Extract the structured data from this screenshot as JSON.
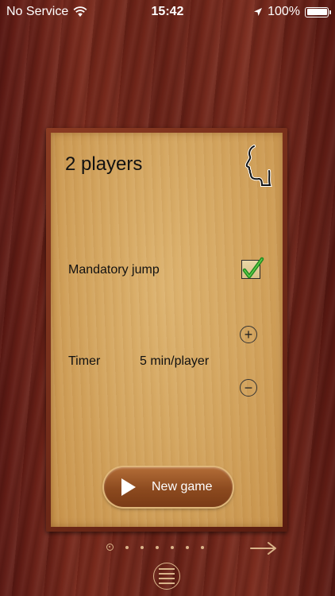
{
  "status_bar": {
    "carrier": "No Service",
    "time": "15:42",
    "battery": "100%",
    "icons": [
      "wifi-icon",
      "location-arrow-icon",
      "battery-icon"
    ]
  },
  "settings": {
    "title": "2 players",
    "mandatory_jump_label": "Mandatory jump",
    "mandatory_jump_checked": true,
    "timer_label": "Timer",
    "timer_value": "5 min/player",
    "plus_symbol": "+",
    "minus_symbol": "−",
    "new_game_label": "New game"
  },
  "pager": {
    "page_count": 7,
    "active_index": 0
  },
  "colors": {
    "accent": "#d9b48a",
    "check_green": "#1f8a1f"
  }
}
